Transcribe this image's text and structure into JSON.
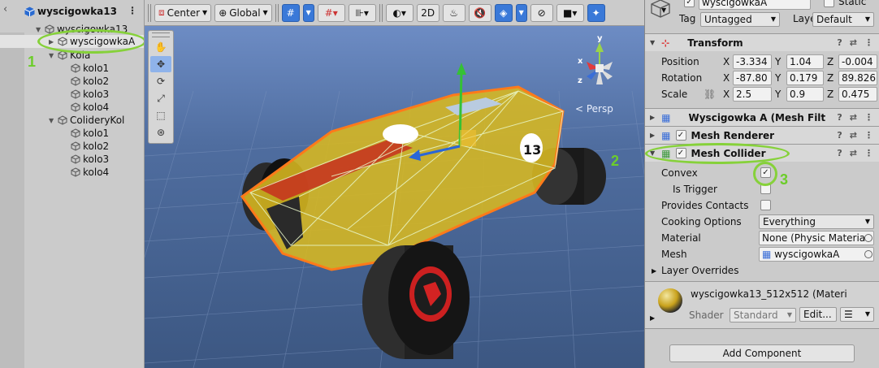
{
  "hierarchy": {
    "scene_name": "wyscigowka13",
    "items": [
      {
        "label": "wyscigowka13",
        "depth": 1,
        "expanded": true
      },
      {
        "label": "wyscigowkaA",
        "depth": 2,
        "expanded": false,
        "selected": true
      },
      {
        "label": "Kola",
        "depth": 2,
        "expanded": true
      },
      {
        "label": "kolo1",
        "depth": 3
      },
      {
        "label": "kolo2",
        "depth": 3
      },
      {
        "label": "kolo3",
        "depth": 3
      },
      {
        "label": "kolo4",
        "depth": 3
      },
      {
        "label": "ColideryKol",
        "depth": 2,
        "expanded": true
      },
      {
        "label": "kolo1",
        "depth": 3
      },
      {
        "label": "kolo2",
        "depth": 3
      },
      {
        "label": "kolo3",
        "depth": 3
      },
      {
        "label": "kolo4",
        "depth": 3
      }
    ]
  },
  "scene_toolbar": {
    "pivot": "Center",
    "space": "Global",
    "mode_2d": "2D"
  },
  "scene": {
    "persp_label": "< Persp",
    "axis_labels": {
      "x": "x",
      "y": "y",
      "z": "z"
    },
    "car_number": "13"
  },
  "inspector": {
    "object_name": "wyscigowkaA",
    "static_label": "Static",
    "tag_label": "Tag",
    "tag_value": "Untagged",
    "layer_label": "Layer",
    "layer_value": "Default",
    "transform": {
      "title": "Transform",
      "position_label": "Position",
      "rotation_label": "Rotation",
      "scale_label": "Scale",
      "position": {
        "x": "-3.334",
        "y": "1.04",
        "z": "-0.004"
      },
      "rotation": {
        "x": "-87.80",
        "y": "0.179",
        "z": "89.826"
      },
      "scale": {
        "x": "2.5",
        "y": "0.9",
        "z": "0.475"
      },
      "axis_x": "X",
      "axis_y": "Y",
      "axis_z": "Z"
    },
    "mesh_filter_title": "Wyscigowka A (Mesh Filt",
    "mesh_renderer_title": "Mesh Renderer",
    "mesh_collider": {
      "title": "Mesh Collider",
      "convex_label": "Convex",
      "convex_checked": true,
      "is_trigger_label": "Is Trigger",
      "provides_contacts_label": "Provides Contacts",
      "cooking_label": "Cooking Options",
      "cooking_value": "Everything",
      "material_label": "Material",
      "material_value": "None (Physic Materia",
      "mesh_label": "Mesh",
      "mesh_value": "wyscigowkaA",
      "layer_overrides_label": "Layer Overrides"
    },
    "material": {
      "name": "wyscigowka13_512x512 (Materi",
      "shader_label": "Shader",
      "shader_value": "Standard",
      "edit_label": "Edit..."
    },
    "add_component_label": "Add Component"
  },
  "annotations": {
    "n1": "1",
    "n2": "2",
    "n3": "3"
  },
  "colors": {
    "highlight": "#86d13a",
    "selection_outline": "#ff7a1a",
    "car_body": "#d8b820",
    "blue_accent": "#3a79d8"
  }
}
